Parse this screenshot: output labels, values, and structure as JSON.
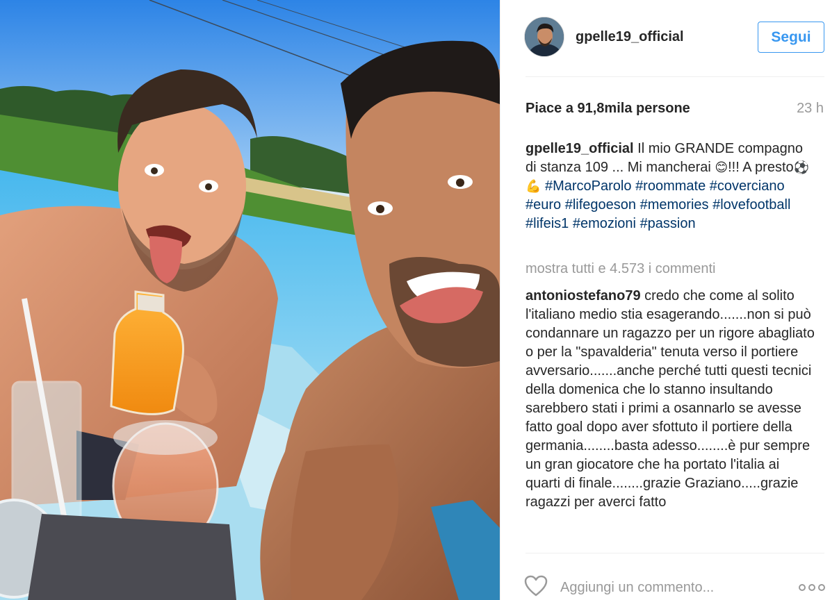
{
  "post": {
    "username": "gpelle19_official",
    "follow_label": "Segui",
    "likes": "Piace a 91,8mila persone",
    "time": "23 h",
    "caption": {
      "username": "gpelle19_official",
      "text_1": " Il mio GRANDE compagno di stanza 109 ... Mi mancherai ",
      "emoji_1": "😊",
      "text_2": "!!! A presto",
      "emoji_2": "⚽💪",
      "hashtags": [
        "#MarcoParolo",
        "#roommate",
        "#coverciano",
        "#euro",
        "#lifegoeson",
        "#memories",
        "#lovefootball",
        "#lifeis1",
        "#emozioni",
        "#passion"
      ]
    },
    "more_comments": "mostra tutti e 4.573 i commenti",
    "comment": {
      "username": "antoniostefano79",
      "text": " credo che come al solito l'italiano medio stia esagerando.......non si può condannare un ragazzo per un rigore abagliato o per la \"spavalderia\" tenuta verso il portiere avversario.......anche perché tutti questi tecnici della domenica che lo stanno insultando sarebbero stati i primi a osannarlo se avesse fatto goal dopo aver sfottuto il portiere della germania........basta adesso........è pur sempre un gran giocatore che ha portato l'italia ai quarti di finale........grazie Graziano.....grazie ragazzi per averci fatto"
    },
    "comment_placeholder": "Aggiungi un commento...",
    "icons": {
      "like": "heart-outline-icon",
      "more": "more-options-icon",
      "avatar": "profile-avatar"
    }
  },
  "colors": {
    "link_blue": "#3897f0",
    "hashtag_blue": "#003569",
    "muted_grey": "#999999",
    "text_dark": "#262626"
  }
}
